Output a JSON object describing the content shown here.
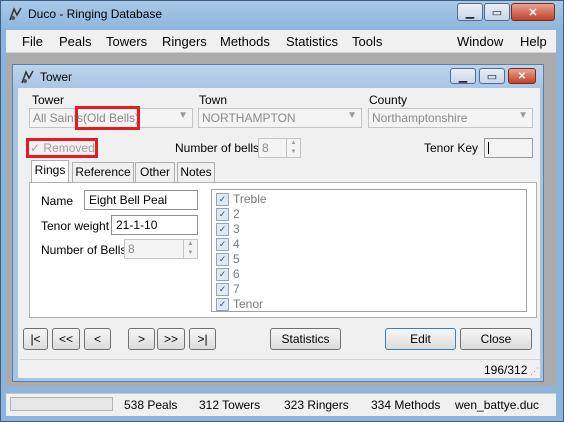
{
  "app": {
    "title": "Duco - Ringing Database"
  },
  "menu": [
    {
      "label": "File"
    },
    {
      "label": "Peals"
    },
    {
      "label": "Towers"
    },
    {
      "label": "Ringers"
    },
    {
      "label": "Methods"
    },
    {
      "label": "Statistics"
    },
    {
      "label": "Tools"
    },
    {
      "label": "Window"
    },
    {
      "label": "Help"
    }
  ],
  "child": {
    "title": "Tower",
    "labels": {
      "tower": "Tower",
      "town": "Town",
      "county": "County"
    },
    "tower_value": "All Saints",
    "tower_value_highlight": "(Old Bells)",
    "town_value": "NORTHAMPTON",
    "county_value": "Northamptonshire",
    "removed_label": "Removed",
    "number_of_bells_label": "Number of bells",
    "number_of_bells_value": "8",
    "tenor_key_label": "Tenor Key",
    "tenor_key_value": "",
    "tabs": [
      {
        "label": "Rings"
      },
      {
        "label": "Reference"
      },
      {
        "label": "Other"
      },
      {
        "label": "Notes"
      }
    ],
    "rings": {
      "name_label": "Name",
      "name_value": "Eight Bell Peal",
      "tenor_weight_label": "Tenor weight",
      "tenor_weight_value": "21-1-10",
      "bells_label": "Number of Bells",
      "bells_value": "8",
      "bell_list": [
        "Treble",
        "2",
        "3",
        "4",
        "5",
        "6",
        "7",
        "Tenor"
      ]
    },
    "nav": {
      "first": "|<",
      "prev_fast": "<<",
      "prev": "<",
      "next": ">",
      "next_fast": ">>",
      "last": ">|"
    },
    "buttons": {
      "statistics": "Statistics",
      "edit": "Edit",
      "close": "Close"
    },
    "record_position": "196/312"
  },
  "status": {
    "peals": "538 Peals",
    "towers": "312 Towers",
    "ringers": "323 Ringers",
    "methods": "334 Methods",
    "file": "wen_battye.duc"
  },
  "colors": {
    "highlight": "#e31b23",
    "titlebar": "#8db5dc"
  }
}
